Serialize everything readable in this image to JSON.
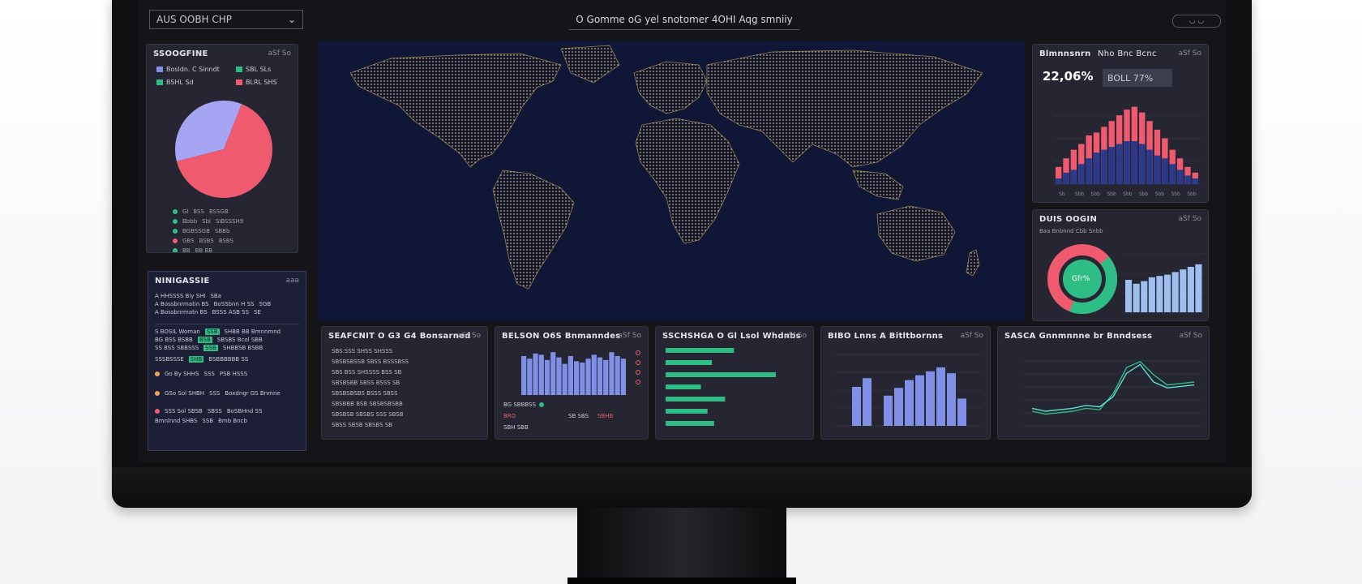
{
  "topbar": {
    "scope_select": "AUS OOBH CHP",
    "headline": "O Gomme oG yel snotomer 4OHI Aqg smniiy",
    "window_controls": "◡ ◡"
  },
  "colors": {
    "accent_green": "#2fbd86",
    "accent_red": "#ef5a6f",
    "accent_lilac": "#a5a5f4",
    "accent_blue": "#7f90e6",
    "map_bg": "#0f1636",
    "map_dots": "#d9b14a"
  },
  "panels": {
    "pie": {
      "title": "SSOOGFINE",
      "menu": "aSf So",
      "legend": [
        {
          "label": "Bosldn. C Sinndt",
          "color": "#7f90e6"
        },
        {
          "label": "SBL SLs",
          "color": "#2fbd86"
        },
        {
          "label": "BSHL Sd",
          "color": "#2fbd86"
        },
        {
          "label": "BLRL SHS",
          "color": "#ef5a6f"
        }
      ],
      "list": [
        {
          "a": "Gl",
          "b": "BSS",
          "c": "BSSGB"
        },
        {
          "a": "Bbbb",
          "b": "Sbl",
          "c": "SIBSSSH9"
        },
        {
          "a": "BGBSSGB",
          "b": "SBBb",
          "c": ""
        },
        {
          "a": "GBS",
          "b": "BSBS",
          "c": "BSBS"
        },
        {
          "a": "BB",
          "b": "BB BB",
          "c": ""
        }
      ]
    },
    "table": {
      "title": "NINIGASSIE",
      "menu": "aaa",
      "rows": [
        {
          "a": "A HHSSSS Biy SHI",
          "b": "",
          "c": "SBa"
        },
        {
          "a": "A Bossbnrmatin BS",
          "b": "BoSSbnn H SS",
          "c": "SGB"
        },
        {
          "a": "A Bossbnrmatn BS",
          "b": "BSSS ASB SS",
          "c": "SE"
        },
        {
          "a": "S BOSIL Woman",
          "b": "SSB",
          "c": "SHBB BB Bmnnmnd"
        },
        {
          "a": "BG BSS BSBB",
          "b": "BSB",
          "c": "SBSBS Bcol SBB"
        },
        {
          "a": "SS BSS SBBSSS",
          "b": "SSB",
          "c": "SHBBSB BSBB"
        },
        {
          "a": "SSSBSSSE",
          "b": "SHB",
          "c": "BSBBBBBB SS"
        },
        {
          "a": "Go By SHHS",
          "b": "SSS",
          "c": "PSB HSSS"
        },
        {
          "a": "GSo Sol SHBH",
          "b": "SSS",
          "c": "Boxdngr GS Bnmne"
        },
        {
          "a": "SSS Sol SBSB",
          "b": "SBSS",
          "c": "BoSBHnd SS"
        },
        {
          "a": "Bmnlnnd SHBS",
          "b": "SSB",
          "c": "Bmb Bncb"
        }
      ]
    },
    "kpi": {
      "title": "Blmnnsnrn",
      "subtitle": "Nho Bnc Bcnc",
      "menu": "aSf So",
      "value": "22,06%",
      "chip": "BOLL 77%",
      "xticks": [
        "Sb",
        "Sbb",
        "Sbb",
        "Sbb",
        "Sbb",
        "Sbb",
        "Sbb",
        "Sbb",
        "Sbb"
      ]
    },
    "donut": {
      "title": "DUIS OOGIN",
      "menu": "aSf So",
      "subtitle": "Baa Bnbnnd Cbb Snbb",
      "center": "Gfr%"
    },
    "b1": {
      "title": "SEAFCNIT O G3 G4 Bonsarned",
      "menu": "aSf So",
      "lines": [
        "SBS SSS SHSS SHSSS",
        "SBSBSBSSB SBSS BSSSBSS",
        "SBS BSS SHSSSS BSS SB",
        "SBSBSBB SBSS BSSS SB",
        "SBSBSBSBS BSSS SBSS",
        "SBSBBB BSB SBSBSBSBB",
        "SBSBSB SBSBS SSS SBSB",
        "SBSS SBSB SBSBS SB"
      ]
    },
    "b2": {
      "title": "BELSON O6S Bnmanndes",
      "menu": "aSf So",
      "legend_a": "BG SBBBSS",
      "legend_b": "BRO",
      "legend_c": "SB SBS",
      "legend_d": "SBHB",
      "legend_e": "SBH SBB"
    },
    "b3": {
      "title": "SSCHSHGA O Gl Lsol Whdnbs",
      "menu": "aSf So"
    },
    "b4": {
      "title": "BIBO Lnns A Bitltbornns",
      "menu": "aSf So"
    },
    "b5": {
      "title": "SASCA Gnnmnnne br Bnndsess",
      "menu": "aSf So"
    }
  },
  "chart_data": [
    {
      "type": "pie",
      "categories": [
        "lilac",
        "pink"
      ],
      "values": [
        35,
        65
      ]
    },
    {
      "type": "bar",
      "series": [
        {
          "values": [
            6,
            9,
            12,
            14,
            17,
            18,
            20,
            22,
            24,
            26,
            27,
            25,
            22,
            19,
            16,
            12,
            9,
            6,
            4
          ]
        },
        {
          "values": [
            2,
            4,
            5,
            7,
            9,
            11,
            12,
            13,
            14,
            15,
            15,
            14,
            12,
            10,
            9,
            7,
            5,
            3,
            2
          ]
        }
      ]
    },
    {
      "type": "bar",
      "values": [
        25,
        22,
        24,
        27,
        28,
        29,
        31,
        33,
        35,
        37
      ]
    },
    {
      "type": "bar",
      "values": [
        30,
        28,
        32,
        31,
        27,
        33,
        29,
        24,
        30,
        26,
        25,
        28,
        31,
        29,
        27,
        33,
        30,
        28
      ]
    },
    {
      "type": "bar",
      "values": [
        62,
        42,
        100,
        32,
        54,
        38,
        44
      ]
    },
    {
      "type": "bar",
      "values": [
        40,
        49,
        0,
        31,
        39,
        47,
        52,
        56,
        60,
        54,
        28
      ]
    },
    {
      "type": "line",
      "series": [
        {
          "values": [
            10,
            8,
            9,
            10,
            12,
            11,
            22,
            40,
            44,
            35,
            28,
            29,
            30
          ]
        },
        {
          "values": [
            12,
            10,
            11,
            12,
            14,
            13,
            20,
            36,
            42,
            30,
            26,
            27,
            28
          ]
        }
      ]
    }
  ]
}
